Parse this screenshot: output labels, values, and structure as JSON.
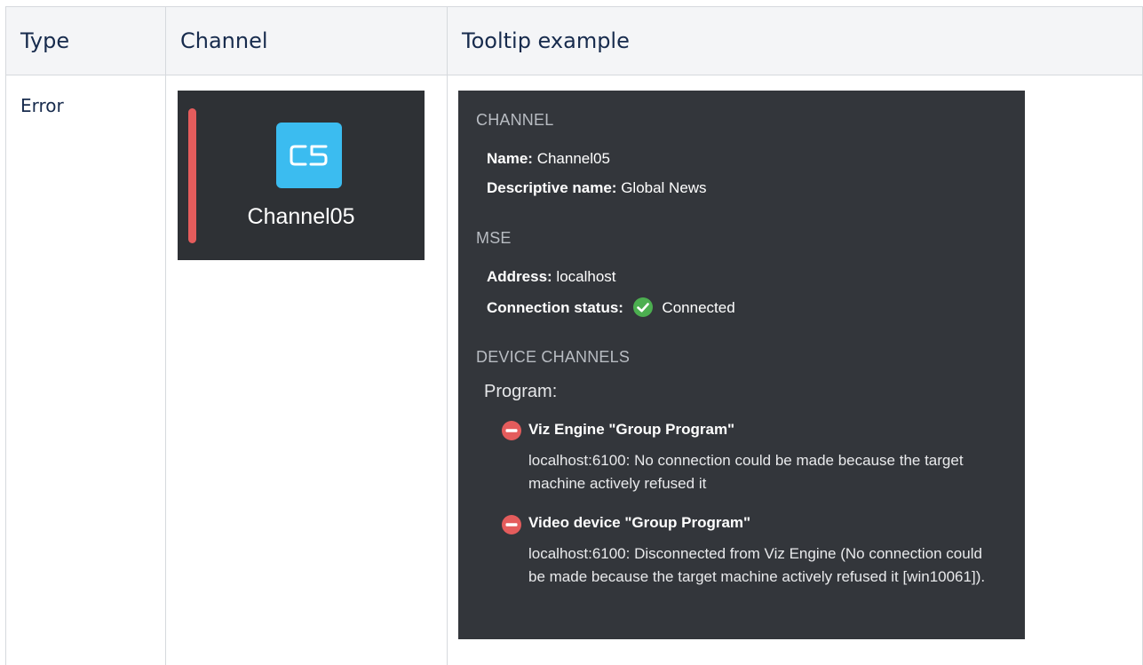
{
  "table": {
    "headers": [
      "Type",
      "Channel",
      "Tooltip example"
    ],
    "row": {
      "type": "Error",
      "channel": {
        "badge_label": "C5",
        "name": "Channel05",
        "status_bar_color": "#e45c5c",
        "badge_color": "#3bbcf0"
      }
    }
  },
  "tooltip": {
    "channel_section": {
      "heading": "CHANNEL",
      "name_label": "Name:",
      "name_value": "Channel05",
      "descriptive_label": "Descriptive name:",
      "descriptive_value": "Global News"
    },
    "mse_section": {
      "heading": "MSE",
      "address_label": "Address:",
      "address_value": "localhost",
      "status_label": "Connection status:",
      "status_value": "Connected",
      "status_icon": "check-circle-icon",
      "status_color": "#4caf50"
    },
    "device_section": {
      "heading": "DEVICE CHANNELS",
      "program_label": "Program:",
      "devices": [
        {
          "icon": "error-minus-icon",
          "title": "Viz Engine \"Group Program\"",
          "message": "localhost:6100: No connection could be made because the target machine actively refused it"
        },
        {
          "icon": "error-minus-icon",
          "title": "Video device \"Group Program\"",
          "message": "localhost:6100: Disconnected from Viz Engine (No connection could be made because the target machine actively refused it [win10061])."
        }
      ],
      "error_color": "#e45c5c"
    }
  }
}
